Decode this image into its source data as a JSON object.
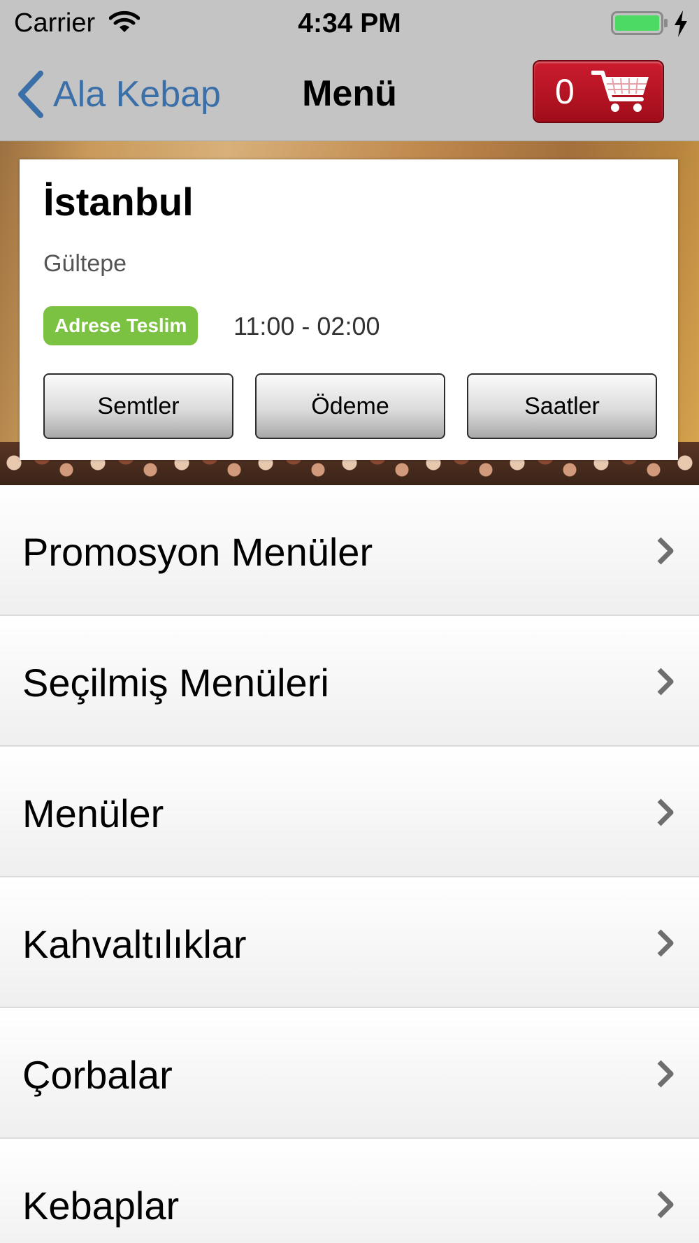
{
  "status_bar": {
    "carrier": "Carrier",
    "time": "4:34 PM"
  },
  "nav": {
    "back_label": "Ala Kebap",
    "title": "Menü",
    "cart_count": "0"
  },
  "info_card": {
    "city": "İstanbul",
    "district": "Gültepe",
    "badge": "Adrese Teslim",
    "hours": "11:00 - 02:00",
    "buttons": [
      "Semtler",
      "Ödeme",
      "Saatler"
    ]
  },
  "menu": {
    "items": [
      "Promosyon Menüler",
      "Seçilmiş Menüleri",
      "Menüler",
      "Kahvaltılıklar",
      "Çorbalar",
      "Kebaplar"
    ]
  },
  "colors": {
    "bar_gray": "#c4c4c4",
    "link_blue": "#3b6fa8",
    "cart_red": "#c0192a",
    "badge_green": "#7cc242",
    "battery_green": "#4cd964"
  },
  "icons": {
    "wifi": "wifi-icon",
    "battery": "battery-icon",
    "charging": "bolt-icon",
    "back": "chevron-left-icon",
    "cart": "cart-icon",
    "row_chevron": "chevron-right-icon"
  }
}
